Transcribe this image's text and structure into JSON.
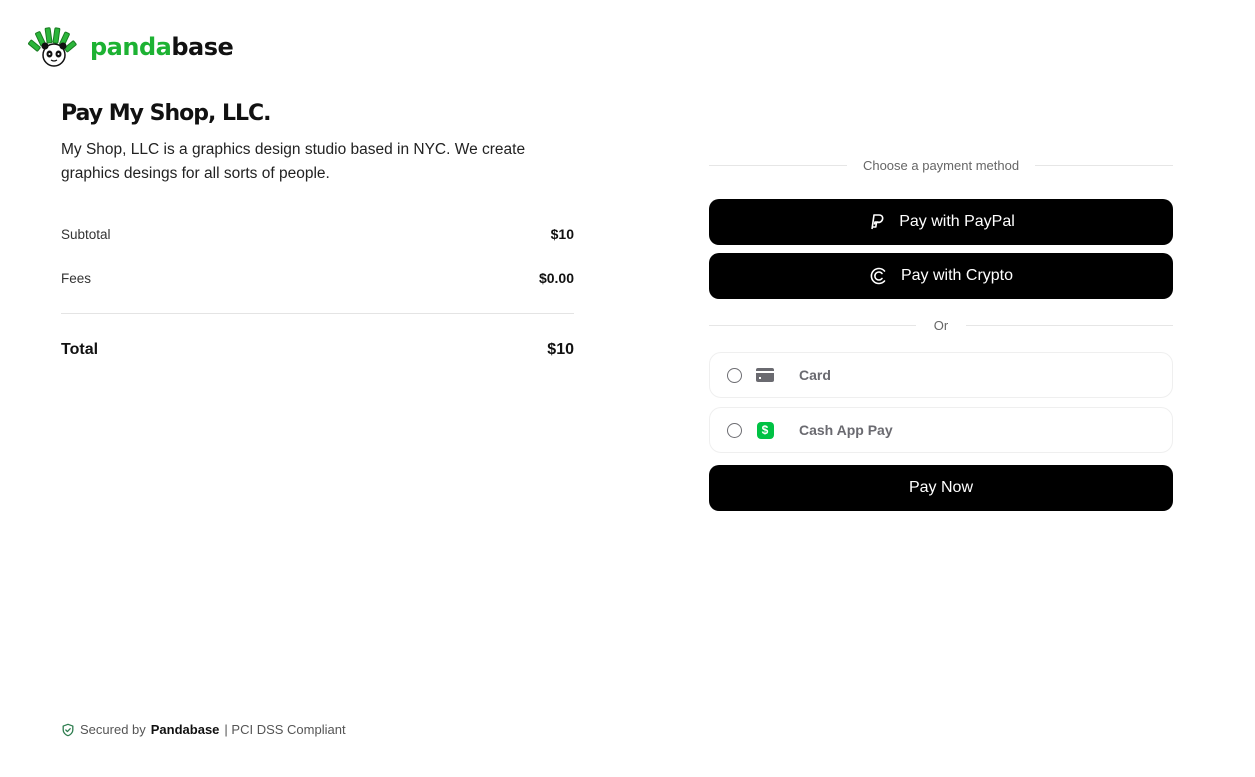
{
  "brand": {
    "name_primary": "panda",
    "name_secondary": "base",
    "accent_color": "#1db233"
  },
  "shop": {
    "title": "Pay My Shop, LLC.",
    "description": "My Shop, LLC is a graphics design studio based in NYC. We create graphics desings for all sorts of people."
  },
  "summary": {
    "subtotal_label": "Subtotal",
    "subtotal_value": "$10",
    "fees_label": "Fees",
    "fees_value": "$0.00",
    "total_label": "Total",
    "total_value": "$10"
  },
  "payment": {
    "heading": "Choose a payment method",
    "paypal_label": "Pay with PayPal",
    "paypal_icon": "paypal-icon",
    "crypto_label": "Pay with Crypto",
    "crypto_icon": "crypto-icon",
    "or_label": "Or",
    "options": [
      {
        "label": "Card",
        "icon": "credit-card-icon",
        "selected": false
      },
      {
        "label": "Cash App Pay",
        "icon": "cash-app-icon",
        "icon_glyph": "$",
        "selected": false
      }
    ],
    "pay_now_label": "Pay Now"
  },
  "footer": {
    "secured_by": "Secured by",
    "brand": "Pandabase",
    "compliance": "| PCI DSS Compliant"
  }
}
